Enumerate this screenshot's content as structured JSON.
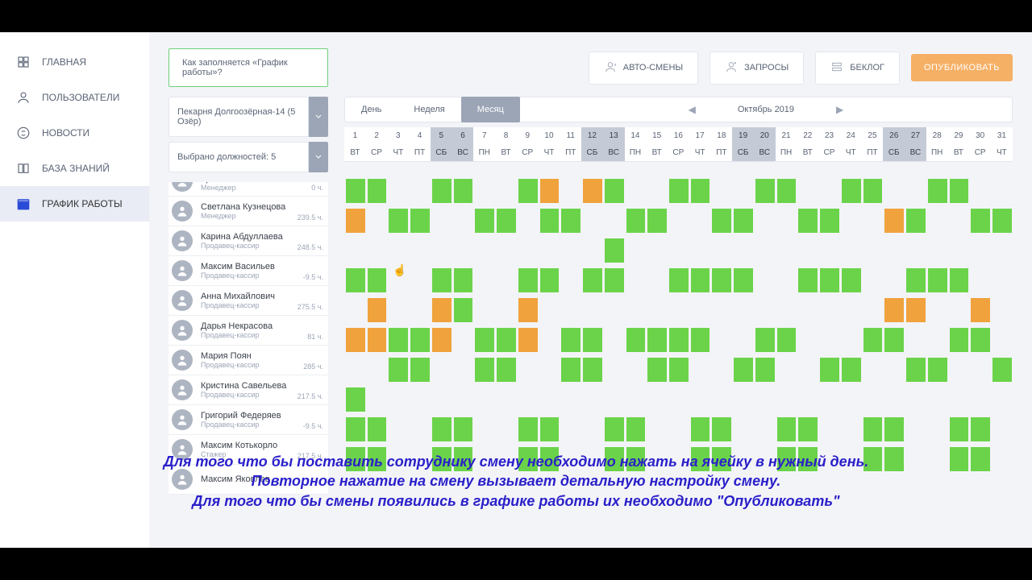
{
  "nav": {
    "items": [
      {
        "label": "ГЛАВНАЯ",
        "key": "home"
      },
      {
        "label": "ПОЛЬЗОВАТЕЛИ",
        "key": "users"
      },
      {
        "label": "НОВОСТИ",
        "key": "news"
      },
      {
        "label": "БАЗА ЗНАНИЙ",
        "key": "kb"
      },
      {
        "label": "ГРАФИК РАБОТЫ",
        "key": "schedule"
      }
    ],
    "active": 4
  },
  "toolbar": {
    "hint": "Как заполняется «График работы»?",
    "auto_shifts": "АВТО-СМЕНЫ",
    "requests": "ЗАПРОСЫ",
    "backlog": "БЕКЛОГ",
    "publish": "ОПУБЛИКОВАТЬ"
  },
  "filters": {
    "location": "Пекарня Долгоозёрная-14 (5 Озёр)",
    "positions": "Выбрано должностей: 5"
  },
  "views": {
    "day": "День",
    "week": "Неделя",
    "month": "Месяц",
    "active": "month",
    "period": "Октябрь 2019"
  },
  "days": {
    "nums": [
      "1",
      "2",
      "3",
      "4",
      "5",
      "6",
      "7",
      "8",
      "9",
      "10",
      "11",
      "12",
      "13",
      "14",
      "15",
      "16",
      "17",
      "18",
      "19",
      "20",
      "21",
      "22",
      "23",
      "24",
      "25",
      "26",
      "27",
      "28",
      "29",
      "30",
      "31"
    ],
    "dows": [
      "ВТ",
      "СР",
      "ЧТ",
      "ПТ",
      "СБ",
      "ВС",
      "ПН",
      "ВТ",
      "СР",
      "ЧТ",
      "ПТ",
      "СБ",
      "ВС",
      "ПН",
      "ВТ",
      "СР",
      "ЧТ",
      "ПТ",
      "СБ",
      "ВС",
      "ПН",
      "ВТ",
      "СР",
      "ЧТ",
      "ПТ",
      "СБ",
      "ВС",
      "ПН",
      "ВТ",
      "СР",
      "ЧТ"
    ],
    "weekend_idx": [
      4,
      5,
      11,
      12,
      18,
      19,
      25,
      26
    ]
  },
  "employees": [
    {
      "name": "Кристина Котова",
      "role": "Менеджер",
      "hours": "0 ч.",
      "shifts": []
    },
    {
      "name": "Светлана Кузнецова",
      "role": "Менеджер",
      "hours": "239.5 ч.",
      "shifts": [
        [
          1,
          "g"
        ],
        [
          2,
          "g"
        ],
        [
          5,
          "g"
        ],
        [
          6,
          "g"
        ],
        [
          9,
          "g"
        ],
        [
          10,
          "o"
        ],
        [
          12,
          "o"
        ],
        [
          13,
          "g"
        ],
        [
          16,
          "g"
        ],
        [
          17,
          "g"
        ],
        [
          20,
          "g"
        ],
        [
          21,
          "g"
        ],
        [
          24,
          "g"
        ],
        [
          25,
          "g"
        ],
        [
          28,
          "g"
        ],
        [
          29,
          "g"
        ]
      ]
    },
    {
      "name": "Карина Абдуллаева",
      "role": "Продавец-кассир",
      "hours": "248.5 ч.",
      "shifts": [
        [
          1,
          "o"
        ],
        [
          3,
          "g"
        ],
        [
          4,
          "g"
        ],
        [
          7,
          "g"
        ],
        [
          8,
          "g"
        ],
        [
          10,
          "g"
        ],
        [
          11,
          "g"
        ],
        [
          14,
          "g"
        ],
        [
          15,
          "g"
        ],
        [
          18,
          "g"
        ],
        [
          19,
          "g"
        ],
        [
          22,
          "g"
        ],
        [
          23,
          "g"
        ],
        [
          26,
          "o"
        ],
        [
          27,
          "g"
        ],
        [
          30,
          "g"
        ],
        [
          31,
          "g"
        ]
      ]
    },
    {
      "name": "Максим Васильев",
      "role": "Продавец-кассир",
      "hours": "-9.5 ч.",
      "shifts": [
        [
          13,
          "g"
        ]
      ]
    },
    {
      "name": "Анна Михайлович",
      "role": "Продавец-кассир",
      "hours": "275.5 ч.",
      "shifts": [
        [
          1,
          "g"
        ],
        [
          2,
          "g"
        ],
        [
          5,
          "g"
        ],
        [
          6,
          "g"
        ],
        [
          9,
          "g"
        ],
        [
          10,
          "g"
        ],
        [
          12,
          "g"
        ],
        [
          13,
          "g"
        ],
        [
          16,
          "g"
        ],
        [
          17,
          "g"
        ],
        [
          18,
          "g"
        ],
        [
          19,
          "g"
        ],
        [
          22,
          "g"
        ],
        [
          23,
          "g"
        ],
        [
          24,
          "g"
        ],
        [
          27,
          "g"
        ],
        [
          28,
          "g"
        ],
        [
          29,
          "g"
        ]
      ]
    },
    {
      "name": "Дарья Некрасова",
      "role": "Продавец-кассир",
      "hours": "81 ч.",
      "shifts": [
        [
          2,
          "o"
        ],
        [
          5,
          "o"
        ],
        [
          6,
          "g"
        ],
        [
          9,
          "o"
        ],
        [
          26,
          "o"
        ],
        [
          27,
          "o"
        ],
        [
          30,
          "o"
        ]
      ]
    },
    {
      "name": "Мария Поян",
      "role": "Продавец-кассир",
      "hours": "285 ч.",
      "shifts": [
        [
          1,
          "o"
        ],
        [
          2,
          "o"
        ],
        [
          3,
          "g"
        ],
        [
          4,
          "g"
        ],
        [
          5,
          "o"
        ],
        [
          7,
          "g"
        ],
        [
          8,
          "g"
        ],
        [
          9,
          "o"
        ],
        [
          11,
          "g"
        ],
        [
          12,
          "g"
        ],
        [
          14,
          "g"
        ],
        [
          15,
          "g"
        ],
        [
          16,
          "g"
        ],
        [
          17,
          "g"
        ],
        [
          20,
          "g"
        ],
        [
          21,
          "g"
        ],
        [
          25,
          "g"
        ],
        [
          26,
          "g"
        ],
        [
          29,
          "g"
        ],
        [
          30,
          "g"
        ]
      ]
    },
    {
      "name": "Кристина Савельева",
      "role": "Продавец-кассир",
      "hours": "217.5 ч.",
      "shifts": [
        [
          3,
          "g"
        ],
        [
          4,
          "g"
        ],
        [
          7,
          "g"
        ],
        [
          8,
          "g"
        ],
        [
          11,
          "g"
        ],
        [
          12,
          "g"
        ],
        [
          15,
          "g"
        ],
        [
          16,
          "g"
        ],
        [
          19,
          "g"
        ],
        [
          20,
          "g"
        ],
        [
          23,
          "g"
        ],
        [
          24,
          "g"
        ],
        [
          27,
          "g"
        ],
        [
          28,
          "g"
        ],
        [
          31,
          "g"
        ]
      ]
    },
    {
      "name": "Григорий Федеряев",
      "role": "Продавец-кассир",
      "hours": "-9.5 ч.",
      "shifts": [
        [
          1,
          "g"
        ]
      ]
    },
    {
      "name": "Максим Котькорло",
      "role": "Стажер",
      "hours": "217.5 ч.",
      "shifts": [
        [
          1,
          "g"
        ],
        [
          2,
          "g"
        ],
        [
          5,
          "g"
        ],
        [
          6,
          "g"
        ],
        [
          9,
          "g"
        ],
        [
          10,
          "g"
        ],
        [
          13,
          "g"
        ],
        [
          14,
          "g"
        ],
        [
          17,
          "g"
        ],
        [
          18,
          "g"
        ],
        [
          21,
          "g"
        ],
        [
          22,
          "g"
        ],
        [
          25,
          "g"
        ],
        [
          26,
          "g"
        ],
        [
          29,
          "g"
        ],
        [
          30,
          "g"
        ]
      ]
    },
    {
      "name": "Максим Яковлев",
      "role": "",
      "hours": "",
      "shifts": [
        [
          1,
          "g"
        ],
        [
          2,
          "g"
        ],
        [
          5,
          "g"
        ],
        [
          6,
          "g"
        ],
        [
          9,
          "g"
        ],
        [
          10,
          "g"
        ],
        [
          13,
          "g"
        ],
        [
          14,
          "g"
        ],
        [
          17,
          "g"
        ],
        [
          18,
          "g"
        ],
        [
          21,
          "g"
        ],
        [
          22,
          "g"
        ],
        [
          25,
          "g"
        ],
        [
          26,
          "g"
        ],
        [
          29,
          "g"
        ],
        [
          30,
          "g"
        ]
      ]
    }
  ],
  "caption": {
    "l1": "Для того что бы поставить сотруднику смену необходимо нажать на ячейку в нужный день.",
    "l2": "Повторное нажатие на смену вызывает детальную настройку смену.",
    "l3": "Для того что бы смены появились в графике работы их необходимо \"Опубликовать\""
  },
  "colors": {
    "green": "#6bd34a",
    "orange": "#f0a23c"
  }
}
